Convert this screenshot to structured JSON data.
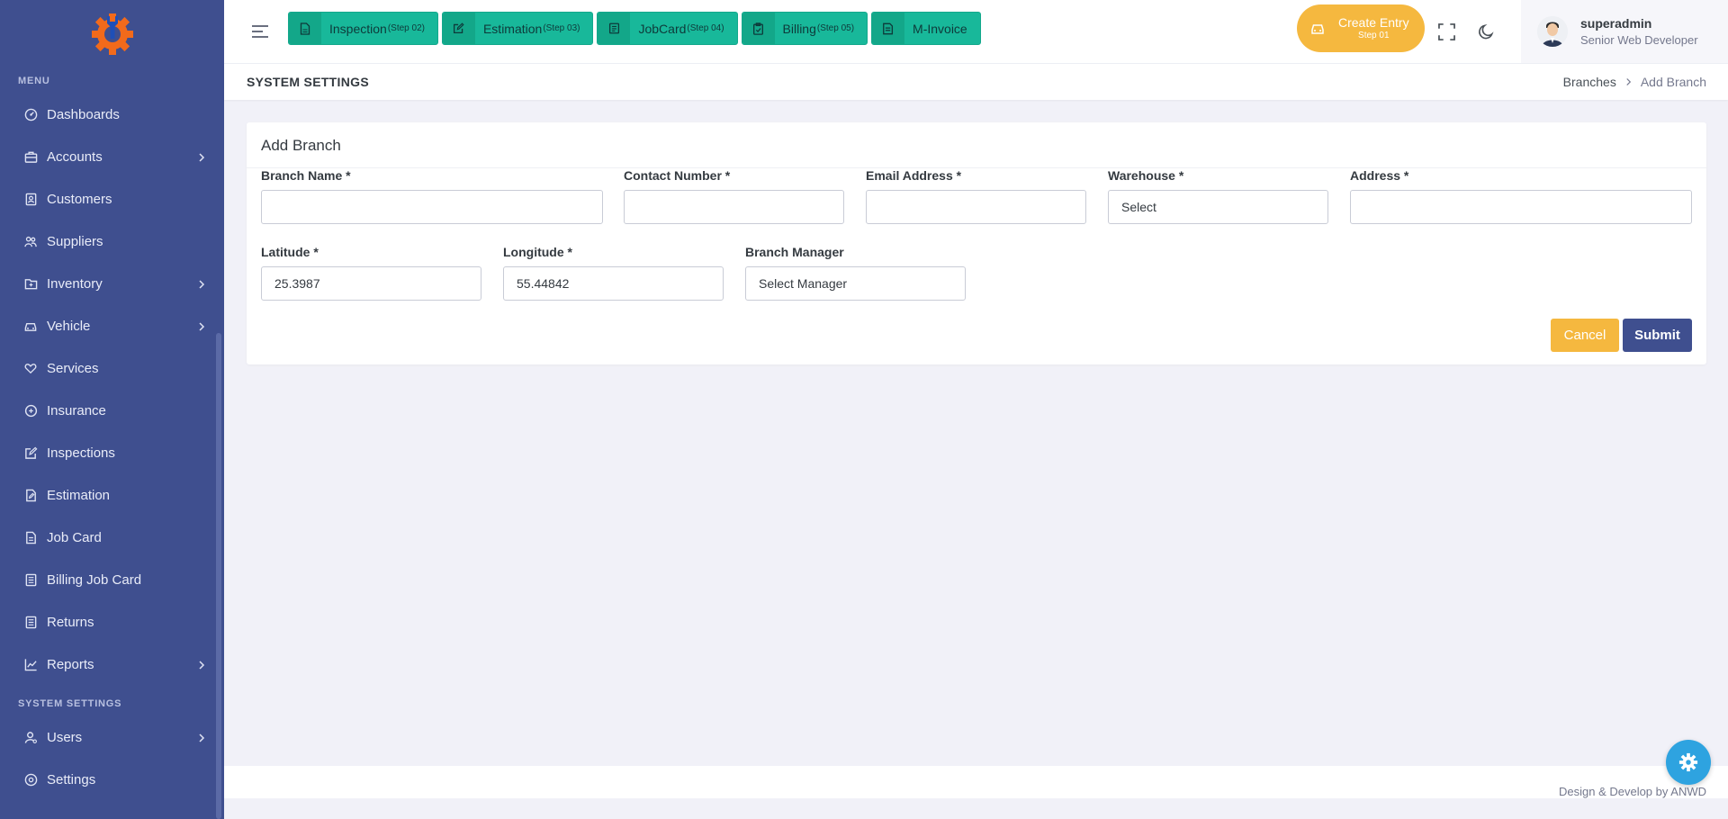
{
  "sidebar": {
    "menu_title": "MENU",
    "system_title": "SYSTEM SETTINGS",
    "items": [
      {
        "label": "Dashboards",
        "icon": "dashboard-icon"
      },
      {
        "label": "Accounts",
        "icon": "briefcase-icon",
        "submenu": true
      },
      {
        "label": "Customers",
        "icon": "contact-icon"
      },
      {
        "label": "Suppliers",
        "icon": "users-icon"
      },
      {
        "label": "Inventory",
        "icon": "folder-icon",
        "submenu": true
      },
      {
        "label": "Vehicle",
        "icon": "car-icon",
        "submenu": true
      },
      {
        "label": "Services",
        "icon": "heart-hand-icon"
      },
      {
        "label": "Insurance",
        "icon": "shield-icon"
      },
      {
        "label": "Inspections",
        "icon": "edit-box-icon"
      },
      {
        "label": "Estimation",
        "icon": "edit-file-icon"
      },
      {
        "label": "Job Card",
        "icon": "file-icon"
      },
      {
        "label": "Billing Job Card",
        "icon": "list-icon"
      },
      {
        "label": "Returns",
        "icon": "list-icon"
      },
      {
        "label": "Reports",
        "icon": "chart-line-icon",
        "submenu": true
      }
    ],
    "system_items": [
      {
        "label": "Users",
        "icon": "user-icon",
        "submenu": true
      },
      {
        "label": "Settings",
        "icon": "settings-icon"
      }
    ]
  },
  "topbar": {
    "steps": [
      {
        "label": "Inspection",
        "sub": "(Step 02)"
      },
      {
        "label": "Estimation",
        "sub": "(Step 03)"
      },
      {
        "label": "JobCard",
        "sub": "(Step 04)"
      },
      {
        "label": "Billing",
        "sub": "(Step 05)"
      },
      {
        "label": "M-Invoice",
        "sub": ""
      }
    ],
    "create_entry": {
      "label": "Create Entry",
      "sub": "Step 01"
    },
    "user": {
      "name": "superadmin",
      "role": "Senior Web Developer"
    }
  },
  "page": {
    "title": "SYSTEM SETTINGS",
    "breadcrumb": [
      "Branches",
      "Add Branch"
    ]
  },
  "form": {
    "title": "Add Branch",
    "branch_name": {
      "label": "Branch Name *",
      "value": ""
    },
    "contact_number": {
      "label": "Contact Number *",
      "value": ""
    },
    "email_address": {
      "label": "Email Address *",
      "value": ""
    },
    "warehouse": {
      "label": "Warehouse *",
      "value": "Select"
    },
    "address": {
      "label": "Address *",
      "value": ""
    },
    "latitude": {
      "label": "Latitude *",
      "value": "25.3987"
    },
    "longitude": {
      "label": "Longitude *",
      "value": "55.44842"
    },
    "branch_manager": {
      "label": "Branch Manager",
      "value": "Select Manager"
    },
    "cancel_label": "Cancel",
    "submit_label": "Submit"
  },
  "footer": {
    "text": "Design & Develop by ANWD"
  },
  "colors": {
    "sidebar_bg": "#3f4f8f",
    "step_green": "#18b89a",
    "accent_yellow": "#f5b83f",
    "primary": "#3f4f8f",
    "fab_blue": "#2ea3e0"
  }
}
